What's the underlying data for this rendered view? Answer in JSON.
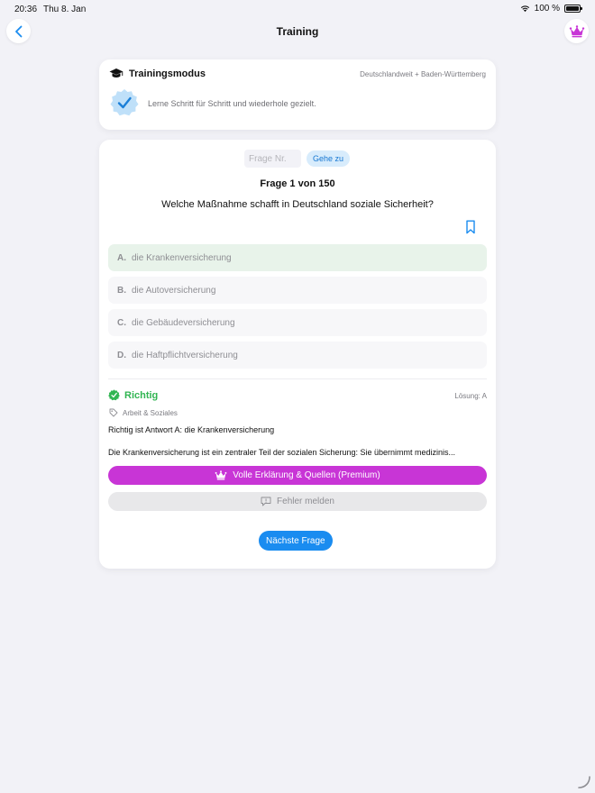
{
  "status": {
    "time": "20:36",
    "date": "Thu 8. Jan",
    "battery": "100 %"
  },
  "nav": {
    "title": "Training"
  },
  "mode": {
    "title": "Trainingsmodus",
    "region": "Deutschlandweit + Baden-Württemberg",
    "description": "Lerne Schritt für Schritt und wiederhole gezielt."
  },
  "quiz": {
    "jump_placeholder": "Frage Nr.",
    "jump_label": "Gehe zu",
    "counter": "Frage 1 von 150",
    "question": "Welche Maßnahme schafft in Deutschland soziale Sicherheit?",
    "answers": [
      {
        "letter": "A.",
        "text": "die Krankenversicherung"
      },
      {
        "letter": "B.",
        "text": "die Autoversicherung"
      },
      {
        "letter": "C.",
        "text": "die Gebäudeversicherung"
      },
      {
        "letter": "D.",
        "text": "die Haftpflichtversicherung"
      }
    ]
  },
  "result": {
    "label": "Richtig",
    "solution": "Lösung: A",
    "category": "Arbeit & Soziales",
    "correct_line": "Richtig ist Antwort A: die Krankenversicherung",
    "explanation": "Die Krankenversicherung ist ein zentraler Teil der sozialen Sicherung: Sie übernimmt medizinis...",
    "premium_label": "Volle Erklärung & Quellen (Premium)",
    "report_label": "Fehler melden",
    "next_label": "Nächste Frage"
  },
  "colors": {
    "accent_blue": "#1a8cf0",
    "premium_purple": "#c835d6",
    "correct_green": "#31b552",
    "correct_bg": "#e8f3ea"
  }
}
